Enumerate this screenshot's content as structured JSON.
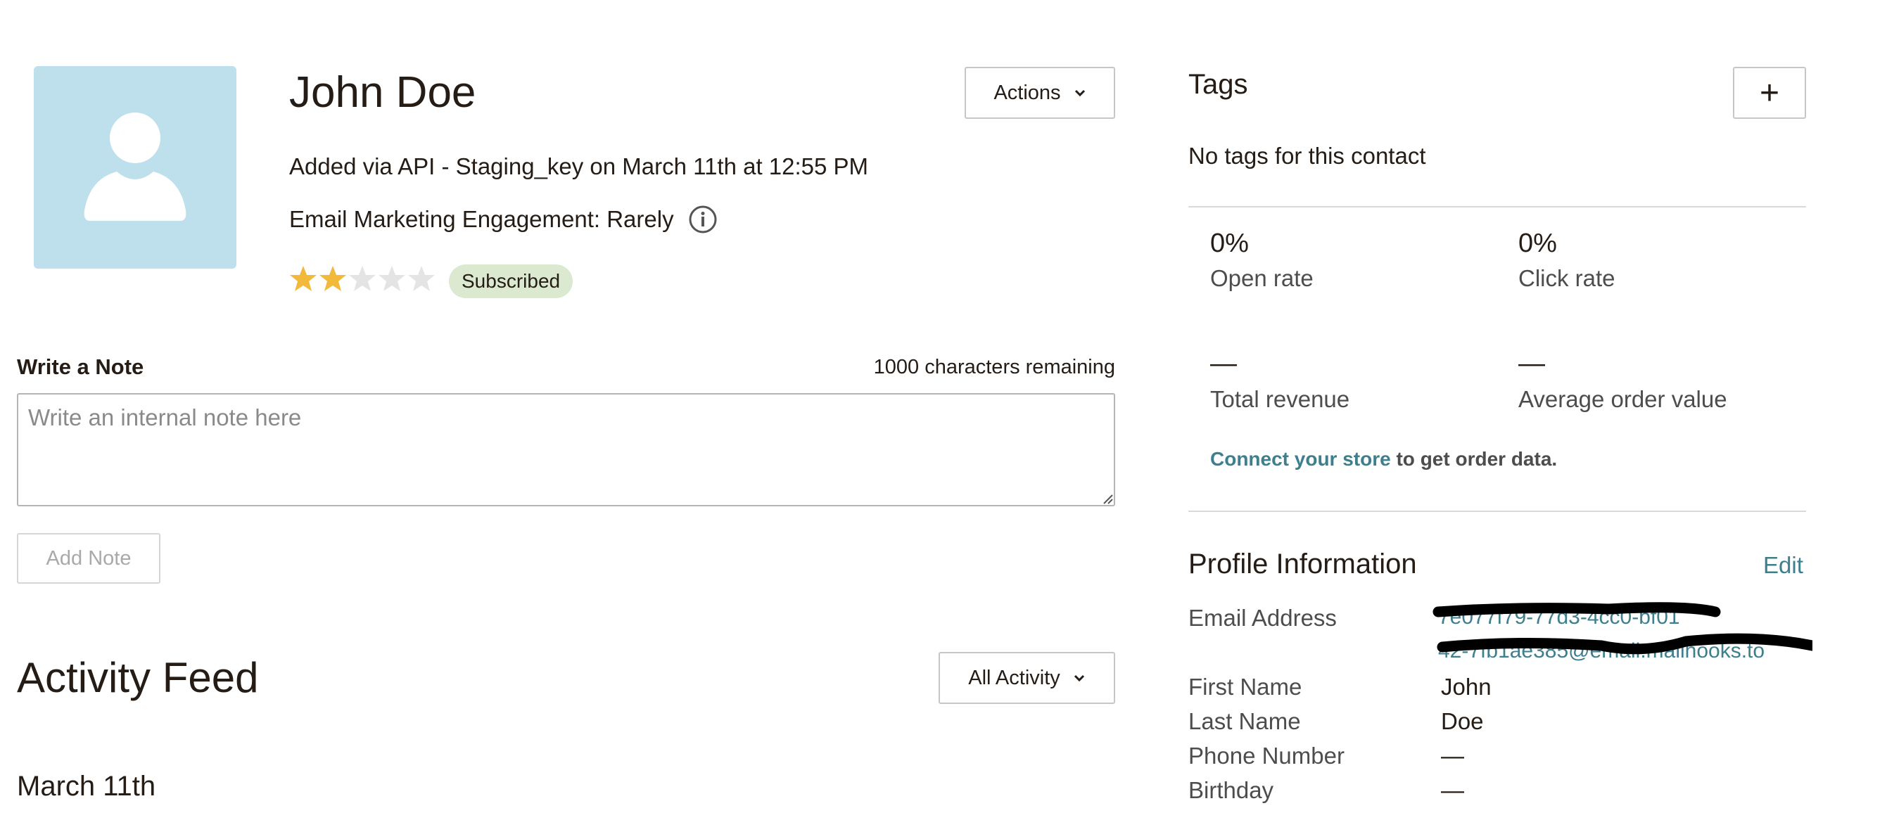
{
  "contact": {
    "name": "John Doe",
    "added_info": "Added via API - Staging_key on March 11th at 12:55 PM",
    "engagement": "Email Marketing Engagement: Rarely",
    "rating": 2,
    "rating_max": 5,
    "status_badge": "Subscribed",
    "actions_label": "Actions"
  },
  "note": {
    "label": "Write a Note",
    "remaining": "1000 characters remaining",
    "placeholder": "Write an internal note here",
    "add_button": "Add Note"
  },
  "activity": {
    "title": "Activity Feed",
    "filter_label": "All Activity",
    "date_heading": "March 11th"
  },
  "tags": {
    "title": "Tags",
    "empty_text": "No tags for this contact",
    "add_symbol": "+"
  },
  "stats": {
    "open_rate_value": "0%",
    "open_rate_label": "Open rate",
    "click_rate_value": "0%",
    "click_rate_label": "Click rate",
    "total_revenue_value": "—",
    "total_revenue_label": "Total revenue",
    "aov_value": "—",
    "aov_label": "Average order value",
    "connect_link": "Connect your store",
    "connect_suffix": " to get order data."
  },
  "profile": {
    "title": "Profile Information",
    "edit_label": "Edit",
    "email_label": "Email Address",
    "email_value_line1": "7e077f79-77d3-4cc0-bf01",
    "email_value_line2": "42-7fb1ae385@email.mailhooks.to",
    "first_name_label": "First Name",
    "first_name_value": "John",
    "last_name_label": "Last Name",
    "last_name_value": "Doe",
    "phone_label": "Phone Number",
    "phone_value": "—",
    "birthday_label": "Birthday",
    "birthday_value": "—"
  },
  "colors": {
    "avatar_bg": "#bde0ec",
    "star_filled": "#f2b93b",
    "star_empty": "#e4e4e4",
    "badge_bg": "#dbe9d0",
    "link": "#3d7f8c"
  }
}
